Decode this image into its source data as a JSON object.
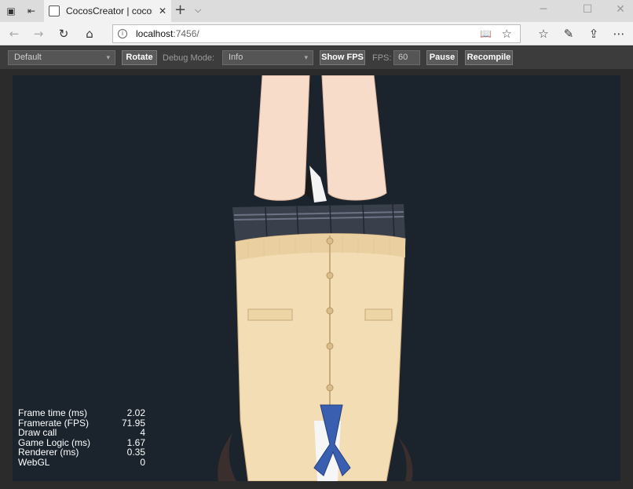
{
  "browser": {
    "tab_title": "CocosCreator | cocos-cr",
    "url_host": "localhost",
    "url_rest": ":7456/"
  },
  "toolbar": {
    "device_select": "Default",
    "rotate_label": "Rotate",
    "debug_mode_label": "Debug Mode:",
    "debug_mode_value": "Info",
    "show_fps_label": "Show FPS",
    "fps_label": "FPS:",
    "fps_value": "60",
    "pause_label": "Pause",
    "recompile_label": "Recompile"
  },
  "stats": [
    {
      "label": "Frame time (ms)",
      "value": "2.02"
    },
    {
      "label": "Framerate (FPS)",
      "value": "71.95"
    },
    {
      "label": "Draw call",
      "value": "4"
    },
    {
      "label": "Game Logic (ms)",
      "value": "1.67"
    },
    {
      "label": "Renderer (ms)",
      "value": "0.35"
    },
    {
      "label": "WebGL",
      "value": "0"
    }
  ],
  "colors": {
    "canvas_bg": "#1b242d",
    "toolbar_bg": "#3c3c3c",
    "cardigan": "#f2ddb4",
    "skirt": "#3a3f4c",
    "ribbon": "#3a5fb0"
  },
  "icons": {
    "tab_actions": "tab-actions-icon",
    "set_aside": "set-aside-tabs-icon",
    "back": "back-arrow-icon",
    "forward": "forward-arrow-icon",
    "refresh": "refresh-icon",
    "home": "home-icon",
    "site_info": "info-icon",
    "reading_view": "reading-view-icon",
    "favorite": "star-icon",
    "favorites_hub": "favorites-hub-icon",
    "notes": "pen-icon",
    "share": "share-icon",
    "more": "more-dots-icon"
  }
}
